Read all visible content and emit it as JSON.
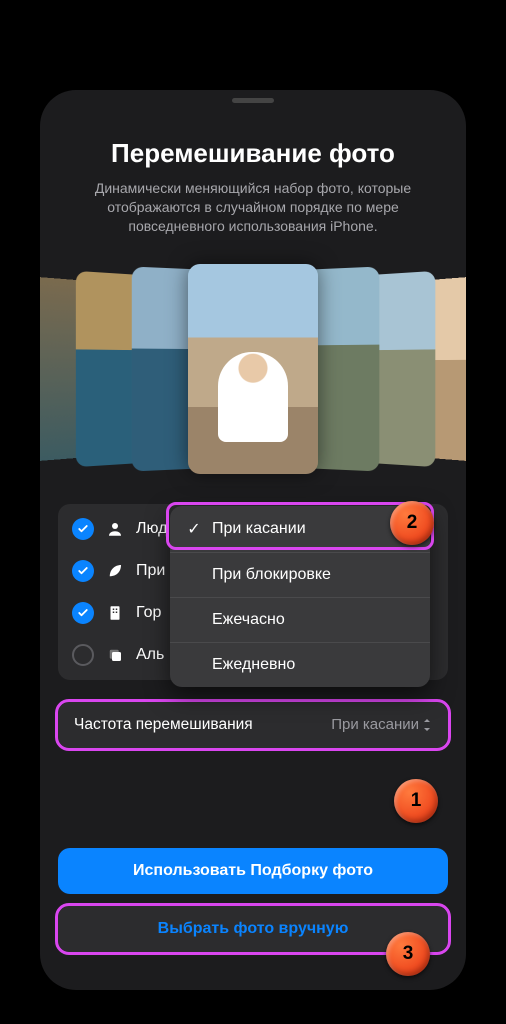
{
  "header": {
    "title": "Перемешивание фото",
    "subtitle": "Динамически меняющийся набор фото, которые отображаются в случайном порядке по мере повседневного использования iPhone."
  },
  "categories": [
    {
      "label": "Люд",
      "checked": true,
      "icon": "person"
    },
    {
      "label": "При",
      "checked": true,
      "icon": "leaf"
    },
    {
      "label": "Гор",
      "checked": true,
      "icon": "building"
    },
    {
      "label": "Аль",
      "checked": false,
      "icon": "stack"
    }
  ],
  "popover": {
    "options": [
      {
        "label": "При касании",
        "selected": true
      },
      {
        "label": "При блокировке",
        "selected": false
      },
      {
        "label": "Ежечасно",
        "selected": false
      },
      {
        "label": "Ежедневно",
        "selected": false
      }
    ]
  },
  "frequency": {
    "label": "Частота перемешивания",
    "value": "При касании"
  },
  "buttons": {
    "primary": "Использовать Подборку фото",
    "secondary": "Выбрать фото вручную"
  },
  "annotations": {
    "b1": "1",
    "b2": "2",
    "b3": "3"
  }
}
